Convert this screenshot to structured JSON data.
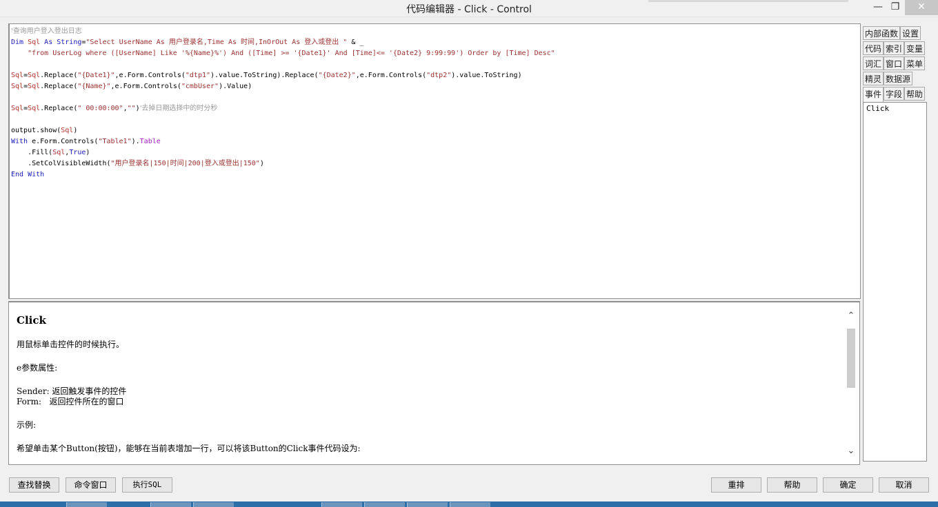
{
  "window": {
    "title": "代码编辑器 - Click - Control",
    "minimize_glyph": "—",
    "restore_glyph": "❐",
    "close_glyph": "✕"
  },
  "editor": {
    "lines": [
      {
        "segments": [
          {
            "cls": "cmt",
            "t": "'查询用户登入登出日志"
          }
        ]
      },
      {
        "segments": [
          {
            "cls": "kw",
            "t": "Dim "
          },
          {
            "cls": "var",
            "t": "Sql"
          },
          {
            "cls": "kw",
            "t": " As String"
          },
          {
            "cls": "txt",
            "t": "="
          },
          {
            "cls": "str",
            "t": "\"Select UserName As 用户登录名,Time As 时间,InOrOut As 登入或登出 \""
          },
          {
            "cls": "txt",
            "t": " & _"
          }
        ]
      },
      {
        "segments": [
          {
            "cls": "txt",
            "t": "    "
          },
          {
            "cls": "str",
            "t": "\"from UserLog where ([UserName] Like '%{Name}%') And ([Time] >= '{Date1}' And [Time]<= '{Date2} 9:99:99') Order by [Time] Desc\""
          }
        ]
      },
      {
        "segments": []
      },
      {
        "segments": [
          {
            "cls": "var",
            "t": "Sql"
          },
          {
            "cls": "txt",
            "t": "="
          },
          {
            "cls": "var",
            "t": "Sql"
          },
          {
            "cls": "txt",
            "t": ".Replace("
          },
          {
            "cls": "str",
            "t": "\"{Date1}\""
          },
          {
            "cls": "txt",
            "t": ",e.Form.Controls("
          },
          {
            "cls": "str",
            "t": "\"dtp1\""
          },
          {
            "cls": "txt",
            "t": ").value.ToString).Replace("
          },
          {
            "cls": "str",
            "t": "\"{Date2}\""
          },
          {
            "cls": "txt",
            "t": ",e.Form.Controls("
          },
          {
            "cls": "str",
            "t": "\"dtp2\""
          },
          {
            "cls": "txt",
            "t": ").value.ToString)"
          }
        ]
      },
      {
        "segments": [
          {
            "cls": "var",
            "t": "Sql"
          },
          {
            "cls": "txt",
            "t": "="
          },
          {
            "cls": "var",
            "t": "Sql"
          },
          {
            "cls": "txt",
            "t": ".Replace("
          },
          {
            "cls": "str",
            "t": "\"{Name}\""
          },
          {
            "cls": "txt",
            "t": ",e.Form.Controls("
          },
          {
            "cls": "str",
            "t": "\"cmbUser\""
          },
          {
            "cls": "txt",
            "t": ").Value)"
          }
        ]
      },
      {
        "segments": []
      },
      {
        "segments": [
          {
            "cls": "var",
            "t": "Sql"
          },
          {
            "cls": "txt",
            "t": "="
          },
          {
            "cls": "var",
            "t": "Sql"
          },
          {
            "cls": "txt",
            "t": ".Replace("
          },
          {
            "cls": "str",
            "t": "\" 00:00:00\""
          },
          {
            "cls": "txt",
            "t": ","
          },
          {
            "cls": "str",
            "t": "\"\""
          },
          {
            "cls": "txt",
            "t": ")"
          },
          {
            "cls": "cmt",
            "t": "'去掉日期选择中的时分秒"
          }
        ]
      },
      {
        "segments": []
      },
      {
        "segments": [
          {
            "cls": "txt",
            "t": "output.show("
          },
          {
            "cls": "var",
            "t": "Sql"
          },
          {
            "cls": "txt",
            "t": ")"
          }
        ]
      },
      {
        "segments": [
          {
            "cls": "kw",
            "t": "With "
          },
          {
            "cls": "txt",
            "t": "e.Form.Controls("
          },
          {
            "cls": "str",
            "t": "\"Table1\""
          },
          {
            "cls": "txt",
            "t": ")."
          },
          {
            "cls": "tbl",
            "t": "Table"
          }
        ]
      },
      {
        "segments": [
          {
            "cls": "txt",
            "t": "    .Fill("
          },
          {
            "cls": "var",
            "t": "Sql"
          },
          {
            "cls": "txt",
            "t": ","
          },
          {
            "cls": "kw",
            "t": "True"
          },
          {
            "cls": "txt",
            "t": ")"
          }
        ]
      },
      {
        "segments": [
          {
            "cls": "txt",
            "t": "    .SetColVisibleWidth("
          },
          {
            "cls": "str",
            "t": "\"用户登录名|150|时间|200|登入或登出|150\""
          },
          {
            "cls": "txt",
            "t": ")"
          }
        ]
      },
      {
        "segments": [
          {
            "cls": "kw",
            "t": "End With"
          }
        ]
      }
    ]
  },
  "help": {
    "title": "Click",
    "lines": [
      "用鼠标单击控件的时候执行。",
      "e参数属性:",
      "Sender: 返回触发事件的控件",
      "Form:   返回控件所在的窗口",
      "示例:",
      "希望单击某个Button(按钮)，能够在当前表增加一行，可以将该Button的Click事件代码设为:"
    ],
    "scroll_up_glyph": "⌃",
    "scroll_down_glyph": "⌄"
  },
  "tabs": [
    {
      "label": "内部函数",
      "active": false
    },
    {
      "label": "设置",
      "active": false
    },
    {
      "label": "代码",
      "active": false
    },
    {
      "label": "索引",
      "active": false
    },
    {
      "label": "变量",
      "active": false
    },
    {
      "label": "词汇",
      "active": false
    },
    {
      "label": "窗口",
      "active": false
    },
    {
      "label": "菜单",
      "active": false
    },
    {
      "label": "精灵",
      "active": false
    },
    {
      "label": "数据源",
      "active": false
    },
    {
      "label": "事件",
      "active": true
    },
    {
      "label": "字段",
      "active": false
    },
    {
      "label": "帮助",
      "active": false
    }
  ],
  "event_list": [
    "Click"
  ],
  "buttons": {
    "find_replace": "查找替换",
    "command_window": "命令窗口",
    "execute_sql": "执行SQL",
    "rearrange": "重排",
    "help": "帮助",
    "ok": "确定",
    "cancel": "取消"
  }
}
